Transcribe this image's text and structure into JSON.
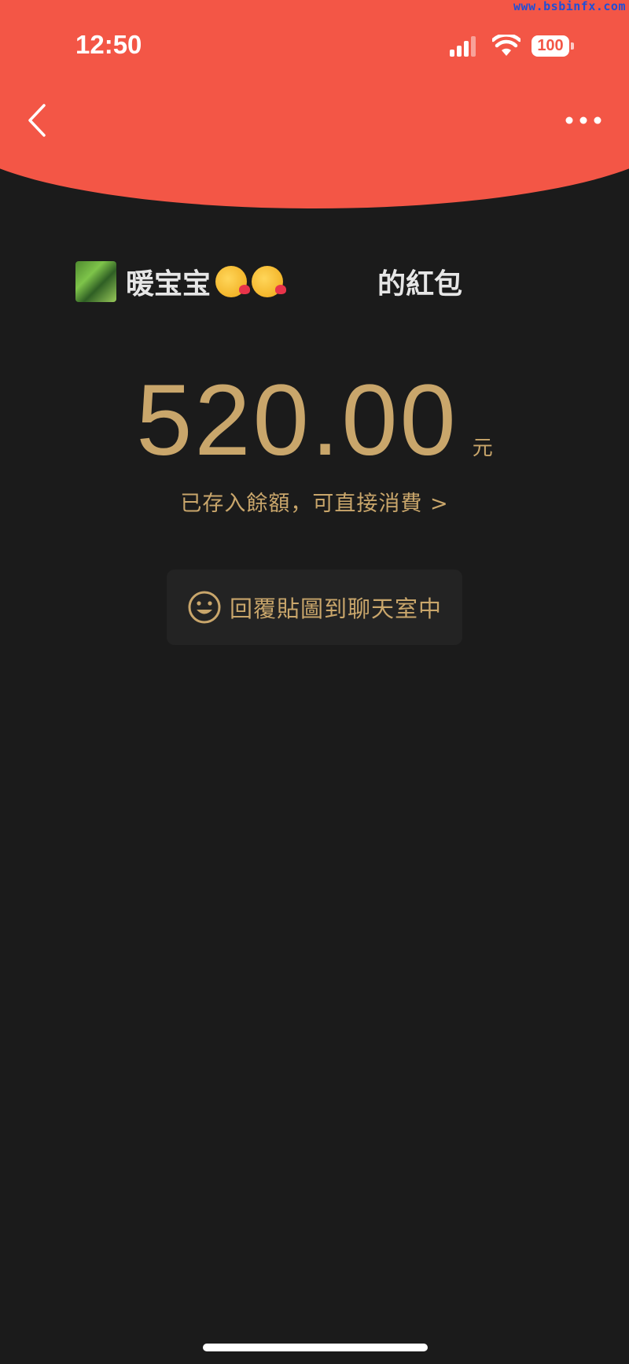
{
  "watermark": "www.bsbinfx.com",
  "status_bar": {
    "time": "12:50",
    "signal": "cellular-signal-icon",
    "wifi": "wifi-icon",
    "battery_level": "100"
  },
  "nav": {
    "back_icon": "chevron-left-icon",
    "more_icon": "more-dots-icon"
  },
  "sender": {
    "name": "暖宝宝",
    "envelope_title": "的紅包"
  },
  "amount": {
    "value": "520.00",
    "unit": "元"
  },
  "balance_link": {
    "text": "已存入餘額，可直接消費 >"
  },
  "reply": {
    "icon": "smile-icon",
    "label": "回覆貼圖到聊天室中"
  },
  "colors": {
    "header": "#f35646",
    "background": "#1b1b1b",
    "gold": "#c9a66b"
  }
}
